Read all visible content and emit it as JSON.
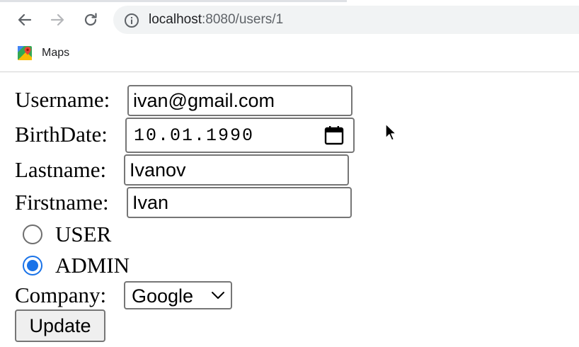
{
  "browser": {
    "url_host": "localhost",
    "url_rest": ":8080/users/1",
    "bookmarks": [
      {
        "label": "Maps",
        "icon": "google-maps-icon"
      }
    ],
    "icons": {
      "back": "arrow-left-icon",
      "forward": "arrow-right-icon",
      "reload": "reload-icon",
      "info": "info-icon"
    }
  },
  "form": {
    "username": {
      "label": "Username:",
      "value": "ivan@gmail.com"
    },
    "birthdate": {
      "label": "BirthDate:",
      "value": "10.01.1990",
      "icon": "calendar-icon"
    },
    "lastname": {
      "label": "Lastname:",
      "value": "Ivanov"
    },
    "firstname": {
      "label": "Firstname:",
      "value": "Ivan"
    },
    "roles": [
      {
        "label": "USER",
        "checked": false
      },
      {
        "label": "ADMIN",
        "checked": true
      }
    ],
    "company": {
      "label": "Company:",
      "selected": "Google",
      "icon": "chevron-down-icon"
    },
    "submit": {
      "label": "Update"
    }
  },
  "colors": {
    "accent": "#1a73e8",
    "omnibox_bg": "#f1f3f4",
    "input_border": "#767676",
    "button_bg": "#efefef"
  }
}
